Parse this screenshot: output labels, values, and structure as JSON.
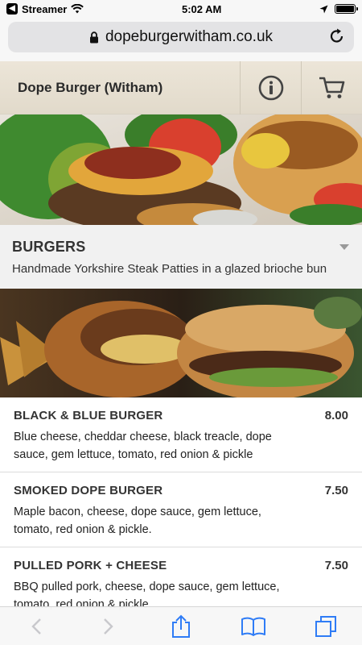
{
  "status_bar": {
    "carrier": "Streamer",
    "time": "5:02 AM",
    "battery_percent": 100
  },
  "browser": {
    "url": "dopeburgerwitham.co.uk"
  },
  "site": {
    "title": "Dope Burger (Witham)"
  },
  "category": {
    "title": "BURGERS",
    "description": "Handmade Yorkshire Steak Patties in a glazed brioche bun"
  },
  "menu_items": [
    {
      "name": "BLACK & BLUE BURGER",
      "price": "8.00",
      "description": "Blue cheese, cheddar cheese, black treacle, dope sauce, gem lettuce, tomato, red onion & pickle"
    },
    {
      "name": "SMOKED DOPE BURGER",
      "price": "7.50",
      "description": "Maple bacon, cheese, dope sauce, gem lettuce, tomato, red onion & pickle."
    },
    {
      "name": "PULLED PORK + CHEESE",
      "price": "7.50",
      "description": "BBQ pulled pork, cheese, dope sauce, gem lettuce, tomato, red onion & pickle"
    }
  ],
  "colors": {
    "ios_blue": "#2f7cf6",
    "header_bg": "#e6dfd0",
    "category_bg": "#f1f1f1"
  }
}
